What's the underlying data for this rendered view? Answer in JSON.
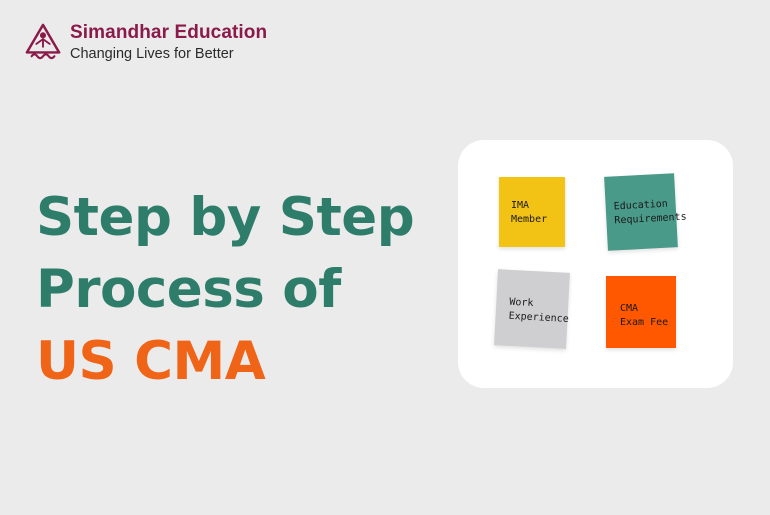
{
  "brand": {
    "name": "Simandhar Education",
    "tagline": "Changing Lives for Better",
    "logo_icon": "simandhar-logo-icon",
    "color": "#8a1a4a"
  },
  "headline": {
    "line1": "Step by Step",
    "line2": "Process of",
    "line3": "US CMA",
    "primary_color": "#2e7d6b",
    "accent_color": "#f06418"
  },
  "notes": [
    {
      "line1": "IMA",
      "line2": "Member",
      "color": "#f2c315"
    },
    {
      "line1": "Education",
      "line2": "Requirements",
      "color": "#4a9a8a"
    },
    {
      "line1": "Work",
      "line2": "Experience",
      "color": "#cfcfd1"
    },
    {
      "line1": "CMA",
      "line2": "Exam Fee",
      "color": "#ff5800"
    }
  ]
}
